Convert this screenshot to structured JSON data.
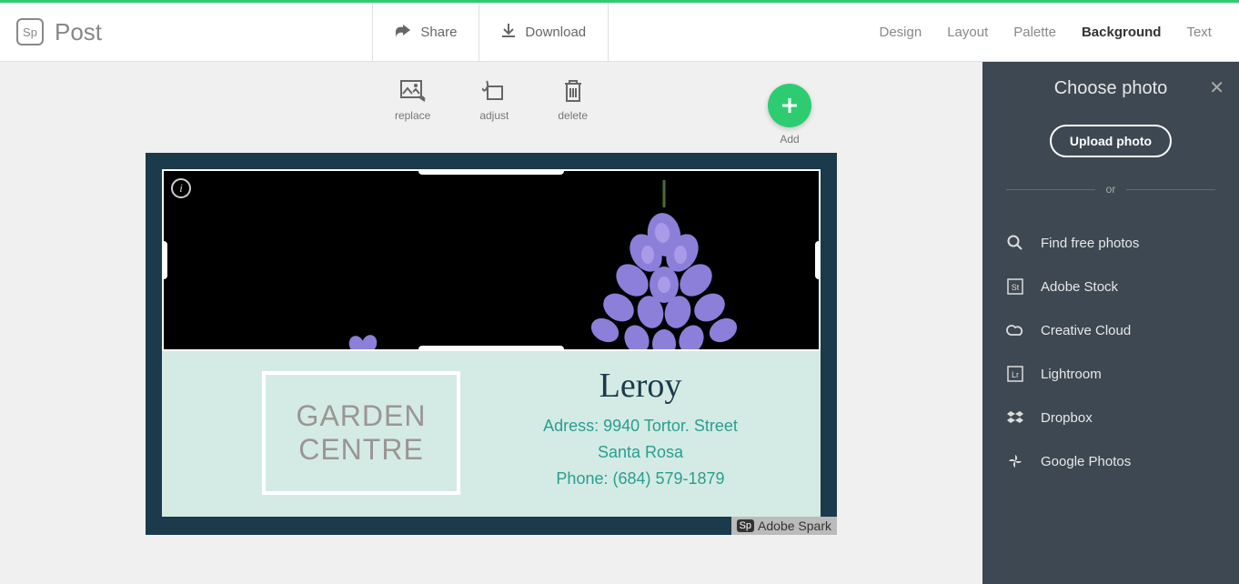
{
  "app": {
    "logo_text": "Sp",
    "title": "Post"
  },
  "header_actions": {
    "share": "Share",
    "download": "Download"
  },
  "tabs": {
    "design": "Design",
    "layout": "Layout",
    "palette": "Palette",
    "background": "Background",
    "text": "Text"
  },
  "toolbar": {
    "replace": "replace",
    "adjust": "adjust",
    "delete": "delete",
    "add": "Add"
  },
  "card": {
    "box_line1": "GARDEN",
    "box_line2": "CENTRE",
    "name": "Leroy",
    "address_line1": "Adress: 9940 Tortor. Street",
    "address_line2": "Santa Rosa",
    "phone": "Phone: (684) 579-1879",
    "watermark": "Adobe Spark",
    "watermark_badge": "Sp"
  },
  "sidebar": {
    "title": "Choose photo",
    "upload": "Upload photo",
    "or": "or",
    "sources": {
      "find": "Find free photos",
      "stock": "Adobe Stock",
      "cc": "Creative Cloud",
      "lr": "Lightroom",
      "dropbox": "Dropbox",
      "gphotos": "Google Photos"
    }
  },
  "colors": {
    "accent": "#2ecc71",
    "sidebar_bg": "#3d4852",
    "canvas_dark": "#1b3a4b",
    "canvas_light": "#d4ebe5",
    "teal": "#2a9d8f"
  }
}
